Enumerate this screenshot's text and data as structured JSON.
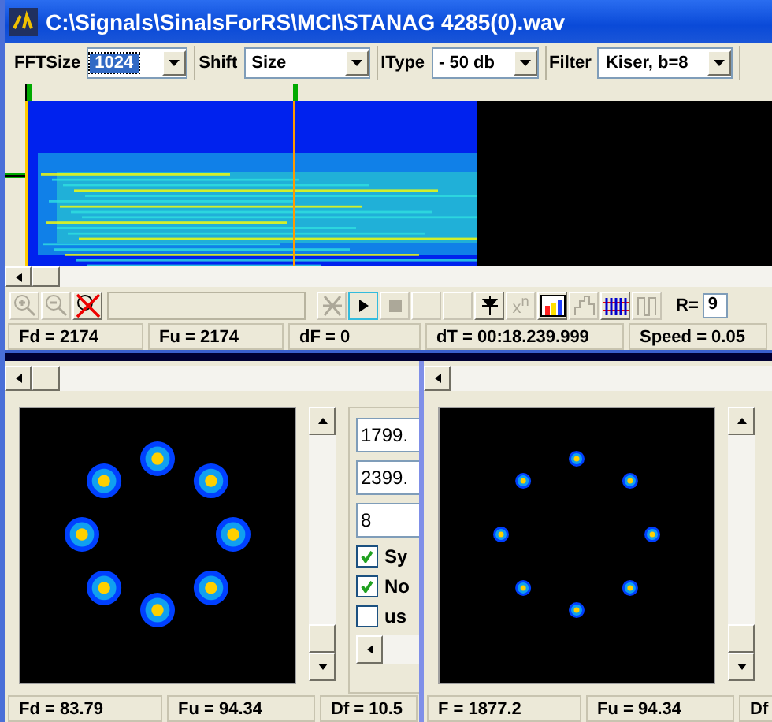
{
  "window": {
    "title": "C:\\Signals\\SinalsForRS\\MCI\\STANAG 4285(0).wav"
  },
  "toolbar": [
    {
      "label": "FFTSize",
      "value": "1024",
      "highlighted": true
    },
    {
      "label": "Shift",
      "value": "Size",
      "highlighted": false
    },
    {
      "label": "IType",
      "value": "- 50 db",
      "highlighted": false
    },
    {
      "label": "Filter",
      "value": "Kiser, b=8",
      "highlighted": false
    }
  ],
  "tools": [
    {
      "kind": "zoom-in",
      "disabled": true,
      "selected": false
    },
    {
      "kind": "zoom-out",
      "disabled": true,
      "selected": false
    },
    {
      "kind": "no-zoom",
      "disabled": false,
      "selected": false
    },
    {
      "kind": "field"
    },
    {
      "kind": "cross",
      "disabled": true,
      "selected": false
    },
    {
      "kind": "play",
      "disabled": false,
      "selected": true
    },
    {
      "kind": "stop",
      "disabled": true,
      "selected": false
    },
    {
      "kind": "blank",
      "disabled": true,
      "selected": false
    },
    {
      "kind": "blank",
      "disabled": true,
      "selected": false
    },
    {
      "kind": "marker",
      "disabled": false,
      "selected": false
    },
    {
      "kind": "power",
      "label": "x$^{n}$",
      "disabled": true,
      "selected": false
    },
    {
      "kind": "bars",
      "disabled": false,
      "selected": false
    },
    {
      "kind": "steps",
      "disabled": true,
      "selected": false
    },
    {
      "kind": "comb",
      "disabled": false,
      "selected": false
    },
    {
      "kind": "pulse",
      "disabled": true,
      "selected": false
    }
  ],
  "r_field": {
    "label": "R=",
    "value": "9"
  },
  "status_bar": [
    "Fd = 2174",
    "Fu = 2174",
    "dF = 0",
    "dT = 00:18.239.999",
    "Speed = 0.05"
  ],
  "left_pane": {
    "fields": [
      "1799.",
      "2399.",
      "8"
    ],
    "checkboxes": [
      {
        "label": "Sy",
        "checked": true
      },
      {
        "label": "No",
        "checked": true
      },
      {
        "label": "us",
        "checked": false
      }
    ],
    "status_bar": [
      "Fd = 83.79",
      "Fu = 94.34",
      "Df = 10.5"
    ]
  },
  "right_pane": {
    "status_bar": [
      "F = 1877.2",
      "Fu = 94.34",
      "Df"
    ]
  }
}
